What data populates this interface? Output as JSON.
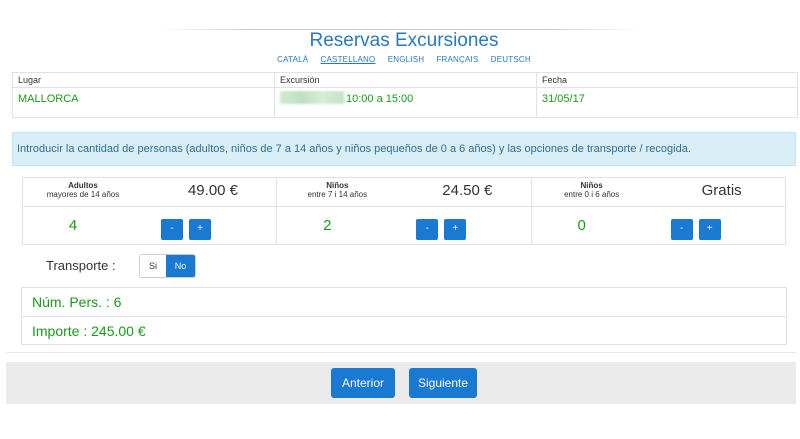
{
  "header": {
    "title": "Reservas Excursiones",
    "languages": [
      {
        "label": "CATALÀ",
        "active": false
      },
      {
        "label": "CASTELLANO",
        "active": true
      },
      {
        "label": "ENGLISH",
        "active": false
      },
      {
        "label": "FRANÇAIS",
        "active": false
      },
      {
        "label": "DEUTSCH",
        "active": false
      }
    ]
  },
  "booking_info": {
    "headers": {
      "place": "Lugar",
      "excursion": "Excursión",
      "date": "Fecha"
    },
    "place": "MALLORCA",
    "excursion_time": "10:00 a 15:00",
    "date": "31/05/17"
  },
  "alert": {
    "text": "Introducir la cantidad de personas (adultos, niños de 7 a 14 años y niños pequeños de 0 a 6 años) y las opciones de transporte / recogida."
  },
  "people": [
    {
      "label": "Adultos",
      "sublabel": "mayores de 14 años",
      "price": "49.00 €",
      "count": "4",
      "minus": "-",
      "plus": "+"
    },
    {
      "label": "Niños",
      "sublabel": "entre 7 i 14 años",
      "price": "24.50 €",
      "count": "2",
      "minus": "-",
      "plus": "+"
    },
    {
      "label": "Niños",
      "sublabel": "entre 0 i 6 años",
      "price": "Gratis",
      "count": "0",
      "minus": "-",
      "plus": "+"
    }
  ],
  "transport": {
    "label": "Transporte :",
    "option_yes": "Si",
    "option_no": "No",
    "selected": "No"
  },
  "summary": {
    "persons": "Núm. Pers. : 6",
    "amount": "Importe : 245.00 €"
  },
  "footer": {
    "prev_label": "Anterior",
    "next_label": "Siguiente"
  },
  "colors": {
    "accent": "#1a79d0",
    "title": "#2a7ab8",
    "value_green": "#1a9a1a",
    "alert_bg": "#d9edf7"
  }
}
